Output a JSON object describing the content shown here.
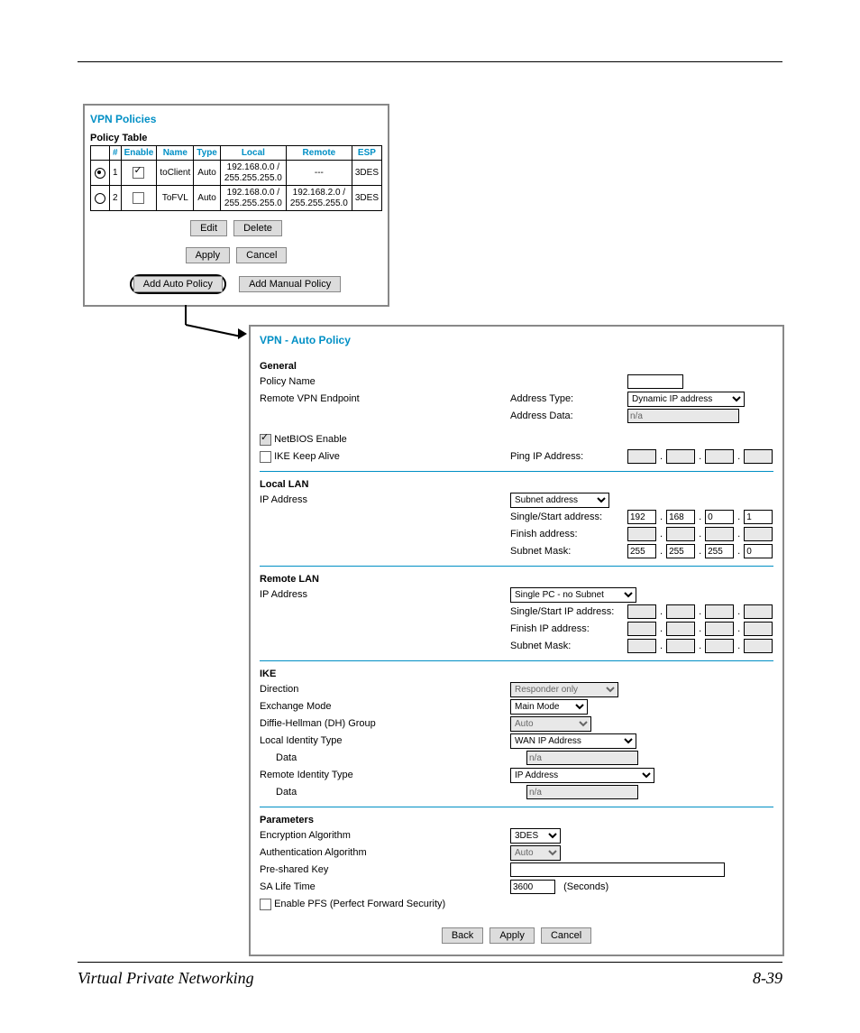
{
  "footer": {
    "left": "Virtual Private Networking",
    "right": "8-39"
  },
  "policies": {
    "title": "VPN Policies",
    "table_label": "Policy Table",
    "headers": {
      "num": "#",
      "enable": "Enable",
      "name": "Name",
      "type": "Type",
      "local": "Local",
      "remote": "Remote",
      "esp": "ESP"
    },
    "rows": [
      {
        "selected": true,
        "num": "1",
        "enabled": true,
        "name": "toClient",
        "type": "Auto",
        "local": "192.168.0.0 / 255.255.255.0",
        "remote": "---",
        "esp": "3DES"
      },
      {
        "selected": false,
        "num": "2",
        "enabled": false,
        "name": "ToFVL",
        "type": "Auto",
        "local": "192.168.0.0 / 255.255.255.0",
        "remote": "192.168.2.0 / 255.255.255.0",
        "esp": "3DES"
      }
    ],
    "buttons": {
      "edit": "Edit",
      "delete": "Delete",
      "apply": "Apply",
      "cancel": "Cancel",
      "add_auto": "Add Auto Policy",
      "add_manual": "Add Manual Policy"
    }
  },
  "auto": {
    "title": "VPN - Auto Policy",
    "general": {
      "heading": "General",
      "policy_name_label": "Policy Name",
      "policy_name_value": "",
      "remote_endpoint_label": "Remote VPN Endpoint",
      "address_type_label": "Address Type:",
      "address_type_value": "Dynamic IP address",
      "address_data_label": "Address Data:",
      "address_data_value": "n/a",
      "netbios_label": "NetBIOS Enable",
      "netbios_checked": true,
      "ike_keepalive_label": "IKE Keep Alive",
      "ike_keepalive_checked": false,
      "ping_ip_label": "Ping IP Address:",
      "ping_ip": [
        "",
        "",
        "",
        ""
      ]
    },
    "local_lan": {
      "heading": "Local LAN",
      "ip_label": "IP Address",
      "mode": "Subnet address",
      "start_label": "Single/Start address:",
      "start": [
        "192",
        "168",
        "0",
        "1"
      ],
      "finish_label": "Finish address:",
      "finish": [
        "",
        "",
        "",
        ""
      ],
      "mask_label": "Subnet Mask:",
      "mask": [
        "255",
        "255",
        "255",
        "0"
      ]
    },
    "remote_lan": {
      "heading": "Remote LAN",
      "ip_label": "IP Address",
      "mode": "Single PC - no Subnet",
      "start_label": "Single/Start IP address:",
      "start": [
        "",
        "",
        "",
        ""
      ],
      "finish_label": "Finish IP address:",
      "finish": [
        "",
        "",
        "",
        ""
      ],
      "mask_label": "Subnet Mask:",
      "mask": [
        "",
        "",
        "",
        ""
      ]
    },
    "ike": {
      "heading": "IKE",
      "direction_label": "Direction",
      "direction_value": "Responder only",
      "exchange_label": "Exchange Mode",
      "exchange_value": "Main Mode",
      "dh_label": "Diffie-Hellman (DH) Group",
      "dh_value": "Auto",
      "local_id_type_label": "Local Identity Type",
      "local_id_type_value": "WAN IP Address",
      "local_data_label": "Data",
      "local_data_value": "n/a",
      "remote_id_type_label": "Remote Identity Type",
      "remote_id_type_value": "IP Address",
      "remote_data_label": "Data",
      "remote_data_value": "n/a"
    },
    "params": {
      "heading": "Parameters",
      "enc_label": "Encryption Algorithm",
      "enc_value": "3DES",
      "auth_label": "Authentication Algorithm",
      "auth_value": "Auto",
      "psk_label": "Pre-shared Key",
      "psk_value": "",
      "sa_label": "SA Life Time",
      "sa_value": "3600",
      "sa_unit": "(Seconds)",
      "pfs_label": "Enable PFS (Perfect Forward Security)",
      "pfs_checked": false
    },
    "buttons": {
      "back": "Back",
      "apply": "Apply",
      "cancel": "Cancel"
    }
  }
}
